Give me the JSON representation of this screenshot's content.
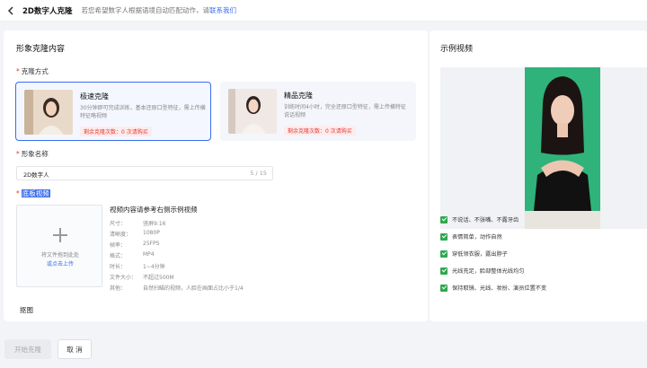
{
  "header": {
    "title": "2D数字人克隆",
    "hint_text": "若您希望数字人根据语境自动匹配动作，请",
    "hint_link": "联系我们"
  },
  "left": {
    "section_title": "形象克隆内容",
    "clone_method_label": "克隆方式",
    "modes": [
      {
        "name": "极速克隆",
        "desc": "30分钟即可完成训练，基本还原口型特征，需上传横特征略视频",
        "quota_prefix": "剩余克隆次数：",
        "quota_value": "0",
        "quota_link": "次请购买",
        "selected": true
      },
      {
        "name": "精品克隆",
        "desc": "训练时间4小时，完全还原口型特征，需上传横特征说话视频",
        "quota_prefix": "剩余克隆次数：",
        "quota_value": "0",
        "quota_link": "次请购买",
        "selected": false
      }
    ],
    "name_label": "形象名称",
    "name_value": "2D数字人",
    "name_count": "5 / 15",
    "video_label": "底板视频",
    "upload_text": "将文件拖到此处",
    "upload_link": "或点击上传",
    "requirements_title": "视频内容请参考右侧示例视频",
    "specs": [
      {
        "k": "尺寸：",
        "v": "竖屏9:16"
      },
      {
        "k": "清晰度：",
        "v": "1080P"
      },
      {
        "k": "帧率：",
        "v": "25FPS"
      },
      {
        "k": "格式：",
        "v": "MP4"
      },
      {
        "k": "时长：",
        "v": "1~4分钟"
      },
      {
        "k": "文件大小：",
        "v": "不超过500M"
      },
      {
        "k": "其他：",
        "v": "自然扫瞄的视频，人脸在画面占比小于1/4"
      }
    ],
    "matting_label": "抠图"
  },
  "right": {
    "title": "示例视频",
    "checks": [
      "不说话、不张嘴、不露牙齿",
      "表情简单，动作自然",
      "穿低领衣服，露出脖子",
      "光线充足，脸部整体光线均匀",
      "保持取镜、光线、妆扮、演员位置不变"
    ]
  },
  "footer": {
    "start_label": "开始克隆",
    "cancel_label": "取 消"
  },
  "colors": {
    "accent": "#3a6df0",
    "danger": "#e53935",
    "green_screen": "#2fb37a",
    "check": "#2fa84f"
  }
}
